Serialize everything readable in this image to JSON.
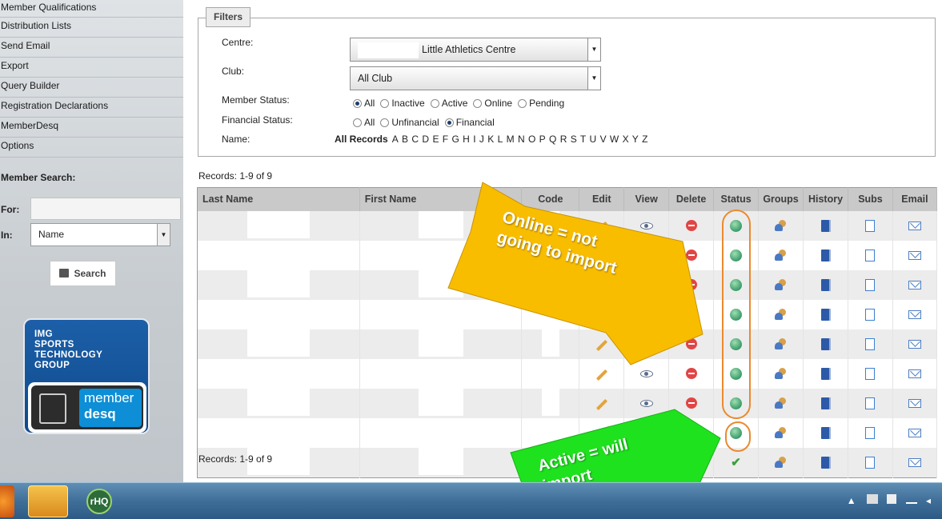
{
  "sidebar": {
    "menu": [
      "Member Qualifications",
      "Distribution Lists",
      "Send Email",
      "Export",
      "Query Builder",
      "Registration Declarations",
      "MemberDesq",
      "Options"
    ],
    "member_search_title": "Member Search:",
    "for_label": "For:",
    "in_label": "In:",
    "in_value": "Name",
    "search_button": "Search",
    "logo_line1": "IMG",
    "logo_line2": "SPORTS",
    "logo_line3": "TECHNOLOGY",
    "logo_line4": "GROUP",
    "logo_product_1": "member",
    "logo_product_2": "desq"
  },
  "filters": {
    "legend": "Filters",
    "centre_label": "Centre:",
    "centre_value": "Little Athletics Centre",
    "club_label": "Club:",
    "club_value": "All Club",
    "member_status_label": "Member Status:",
    "member_status_options": [
      "All",
      "Inactive",
      "Active",
      "Online",
      "Pending"
    ],
    "member_status_selected": "All",
    "financial_status_label": "Financial Status:",
    "financial_status_options": [
      "All",
      "Unfinancial",
      "Financial"
    ],
    "financial_status_selected": "Financial",
    "name_label": "Name:",
    "all_records": "All Records",
    "letters": [
      "A",
      "B",
      "C",
      "D",
      "E",
      "F",
      "G",
      "H",
      "I",
      "J",
      "K",
      "L",
      "M",
      "N",
      "O",
      "P",
      "Q",
      "R",
      "S",
      "T",
      "U",
      "V",
      "W",
      "X",
      "Y",
      "Z"
    ]
  },
  "records_text": "Records: 1-9 of 9",
  "table": {
    "headers": [
      "Last Name",
      "First Name",
      "Code",
      "Edit",
      "View",
      "Delete",
      "Status",
      "Groups",
      "History",
      "Subs",
      "Email"
    ],
    "row_statuses": [
      "online",
      "online",
      "online",
      "online",
      "online",
      "online",
      "online",
      "online",
      "active"
    ]
  },
  "annotations": {
    "yellow": "Online = not going to import",
    "yellow_line1": "Online = not",
    "yellow_line2": "going to import",
    "green_line1": "Active = will",
    "green_line2": "import",
    "yellow_color": "#f9bd00",
    "green_color": "#1ee21e",
    "oval_color": "#ea8a2f"
  },
  "taskbar": {
    "app_label": "rHQ"
  }
}
